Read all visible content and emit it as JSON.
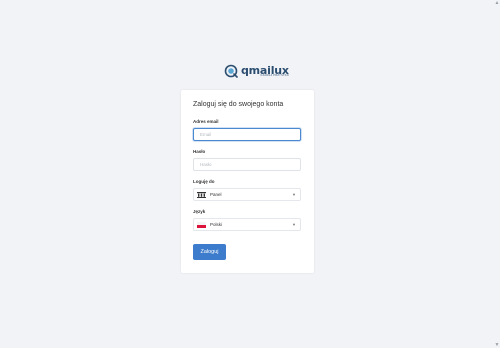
{
  "brand": {
    "name": "qmailux",
    "tagline": "CZARNA PRZYSTAŃ"
  },
  "login": {
    "title": "Zaloguj się do swojego konta",
    "email_label": "Adres email",
    "email_placeholder": "Email",
    "password_label": "Hasło",
    "password_placeholder": "Hasło",
    "login_to_label": "Loguję do",
    "login_to_value": "Panel",
    "language_label": "Język",
    "language_value": "Polski",
    "submit_label": "Zaloguj"
  },
  "colors": {
    "background": "#f1f3f6",
    "accent": "#3d7ccc",
    "brand": "#2b4d6f"
  },
  "icons": [
    "logo-mark-icon",
    "panel-icon",
    "poland-flag-icon",
    "chevron-down-icon"
  ]
}
